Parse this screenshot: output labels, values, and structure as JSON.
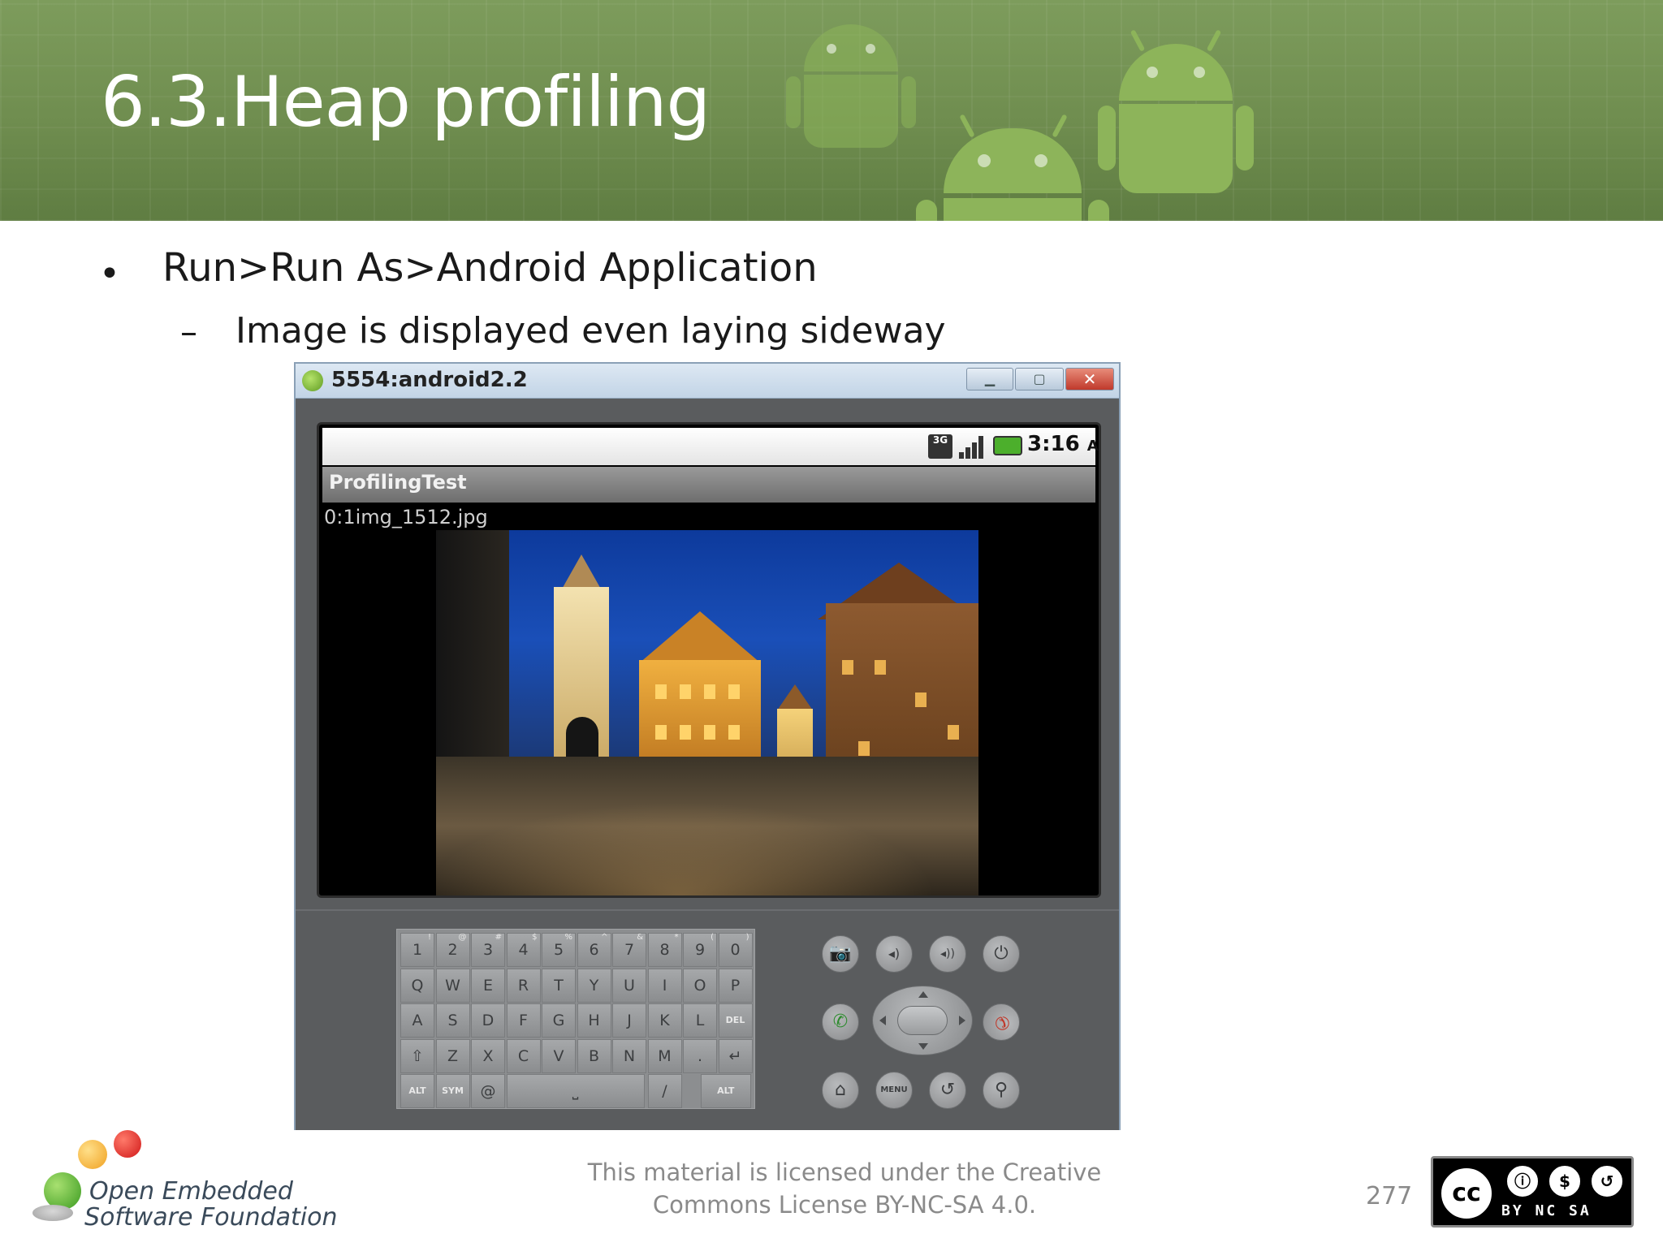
{
  "slide": {
    "title": "6.3.Heap profiling",
    "bullet_1": "Run>Run As>Android Application",
    "bullet_2": "Image is displayed even laying sideway",
    "bullet_marker": "•",
    "dash_marker": "–"
  },
  "emulator": {
    "window_title": "5554:android2.2",
    "status_network": "3G",
    "status_time": "3:16",
    "status_ampm": "AM",
    "app_title": "ProfilingTest",
    "file_label": "0:1img_1512.jpg",
    "keyboard": {
      "row1": [
        "1",
        "2",
        "3",
        "4",
        "5",
        "6",
        "7",
        "8",
        "9",
        "0"
      ],
      "row1_sup": [
        "!",
        "@",
        "#",
        "$",
        "%",
        "^",
        "&",
        "*",
        "(",
        ")"
      ],
      "row2": [
        "Q",
        "W",
        "E",
        "R",
        "T",
        "Y",
        "U",
        "I",
        "O",
        "P"
      ],
      "row3": [
        "A",
        "S",
        "D",
        "F",
        "G",
        "H",
        "J",
        "K",
        "L",
        "DEL"
      ],
      "row4": [
        "⇧",
        "Z",
        "X",
        "C",
        "V",
        "B",
        "N",
        "M",
        ".",
        "↵"
      ],
      "row5_left": [
        "ALT",
        "SYM",
        "@"
      ],
      "row5_right": [
        "/",
        "ALT"
      ]
    },
    "buttons": {
      "camera": "📷",
      "vol_down": "◂)",
      "vol_up": "◂))",
      "power": "⏻",
      "call": "✆",
      "end": "✆",
      "home": "⌂",
      "menu": "MENU",
      "back": "↺",
      "search": "⚲"
    }
  },
  "footer": {
    "logo_line1": "Open Embedded",
    "logo_line2": "Software Foundation",
    "license_line1": "This material is licensed under the Creative",
    "license_line2": "Commons License BY-NC-SA 4.0.",
    "page_number": "277",
    "cc_label": "cc",
    "cc_terms": "BY NC SA"
  },
  "colors": {
    "header_green": "#6f8d4f",
    "title_white": "#ffffff",
    "emulator_gray": "#5a5c5e"
  }
}
